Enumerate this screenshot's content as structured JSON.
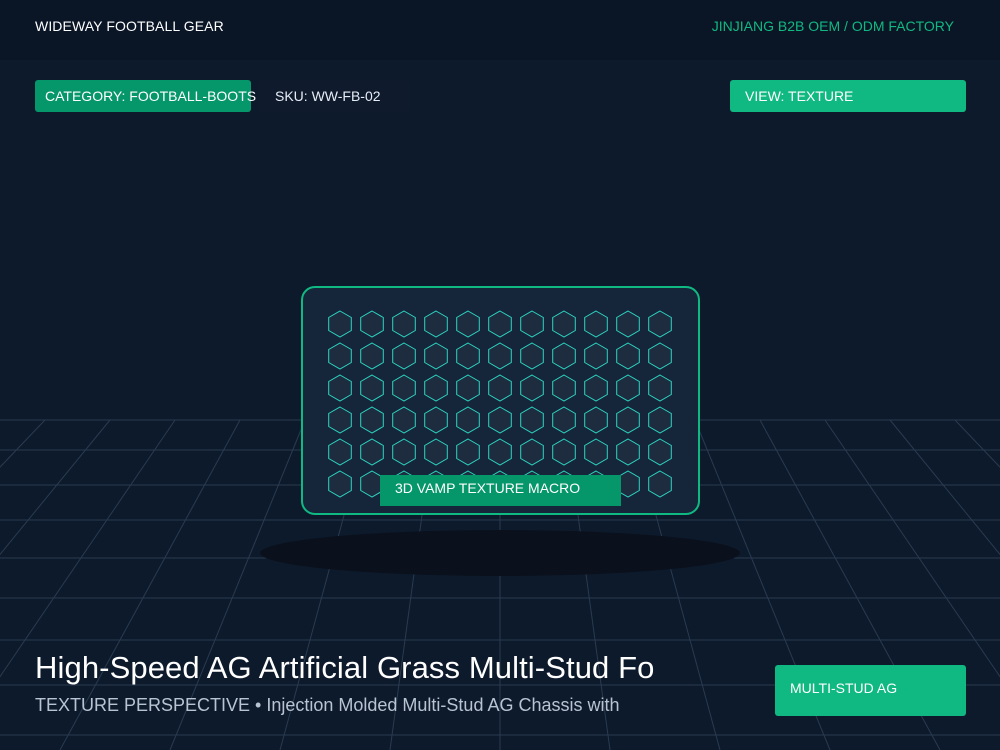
{
  "header": {
    "brand": "WIDEWAY FOOTBALL GEAR",
    "factory": "JINJIANG B2B OEM / ODM FACTORY"
  },
  "chips": {
    "category": "CATEGORY: FOOTBALL-BOOTS",
    "sku": "SKU: WW-FB-02",
    "view": "VIEW: TEXTURE"
  },
  "texture_panel": {
    "label": "3D VAMP TEXTURE MACRO",
    "icon": "hexagon-icon"
  },
  "product": {
    "title": "High-Speed AG Artificial Grass Multi-Stud Fo",
    "subtitle": "TEXTURE PERSPECTIVE • Injection Molded Multi-Stud AG Chassis with",
    "badge": "MULTI-STUD AG"
  },
  "colors": {
    "background": "#0d1a2c",
    "accent": "#10b981",
    "accent_dark": "#059669",
    "grid": "#2a3a50"
  }
}
